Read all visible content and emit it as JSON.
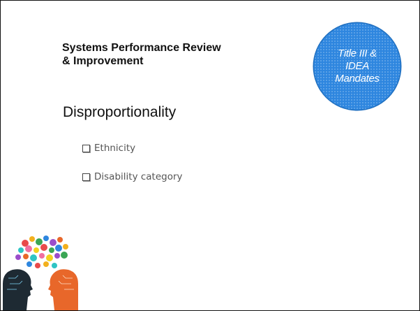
{
  "slide": {
    "title_line1": "Systems Performance Review",
    "title_line2": "& Improvement",
    "badge": {
      "line1": "Title III &",
      "line2": "IDEA",
      "line3": "Mandates",
      "color": "#2e86df"
    },
    "heading": "Disproportionality",
    "bullets": [
      {
        "label": "Ethnicity",
        "icon": "checkbox-icon"
      },
      {
        "label": "Disability category",
        "icon": "checkbox-icon"
      }
    ]
  },
  "illustration": {
    "name": "two-heads-ideas-illustration",
    "colors": {
      "left_head": "#1e2a33",
      "right_head": "#e8672a"
    }
  }
}
